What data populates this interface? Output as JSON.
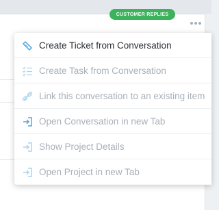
{
  "badge": {
    "label": "CUSTOMER REPLIES",
    "color": "#3bb25b"
  },
  "more_button": {
    "icon": "more-dots-icon"
  },
  "menu": {
    "items": [
      {
        "label": "Create Ticket from Conversation",
        "icon": "ticket-icon",
        "enabled": true
      },
      {
        "label": "Create Task from Conversation",
        "icon": "task-list-icon",
        "enabled": false
      },
      {
        "label": "Link this conversation to an existing item",
        "icon": "link-icon",
        "enabled": false
      },
      {
        "label": "Open Conversation in new Tab",
        "icon": "open-external-icon",
        "enabled": false
      },
      {
        "label": "Show Project Details",
        "icon": "open-external-icon",
        "enabled": false
      },
      {
        "label": "Open Project in new Tab",
        "icon": "open-external-icon",
        "enabled": false
      }
    ]
  },
  "colors": {
    "icon_accent": "#4aa3df",
    "icon_muted": "#a9d3ef",
    "text_active": "#2a2f35",
    "text_muted": "#a9b0b8"
  }
}
